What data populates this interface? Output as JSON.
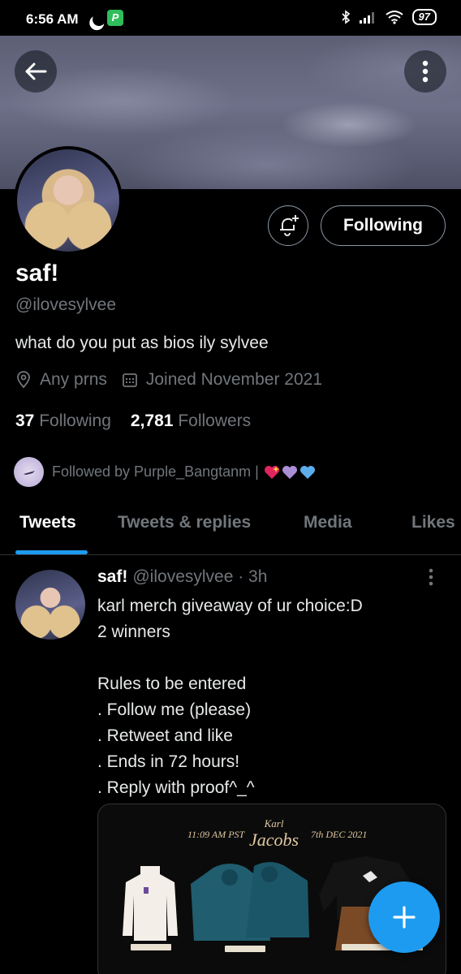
{
  "status_bar": {
    "time": "6:56 AM",
    "app_badge": "P",
    "battery": "97"
  },
  "profile": {
    "display_name": "saf!",
    "handle": "@ilovesylvee",
    "bio": "what do you put as bios ily sylvee",
    "location": "Any prns",
    "joined": "Joined November 2021",
    "following_count": "37",
    "following_label": "Following",
    "followers_count": "2,781",
    "followers_label": "Followers",
    "followed_by": "Followed by Purple_Bangtanm |",
    "following_button": "Following"
  },
  "tabs": [
    {
      "label": "Tweets",
      "active": true
    },
    {
      "label": "Tweets & replies",
      "active": false
    },
    {
      "label": "Media",
      "active": false
    },
    {
      "label": "Likes",
      "active": false
    }
  ],
  "tweet": {
    "name": "saf!",
    "meta": "@ilovesylvee · 3h",
    "lines": [
      "karl merch giveaway of ur choice:D",
      "2 winners",
      "",
      "Rules to be entered",
      ". Follow me (please)",
      ". Retweet and like",
      ". Ends in 72 hours!",
      ". Reply with proof^_^"
    ],
    "media": {
      "time": "11:09 AM PST",
      "brand_top": "Karl",
      "brand_bottom": "Jacobs",
      "date": "7th DEC 2021"
    }
  },
  "colors": {
    "accent": "#1d9bf0",
    "muted": "#71767b",
    "background": "#000000"
  }
}
